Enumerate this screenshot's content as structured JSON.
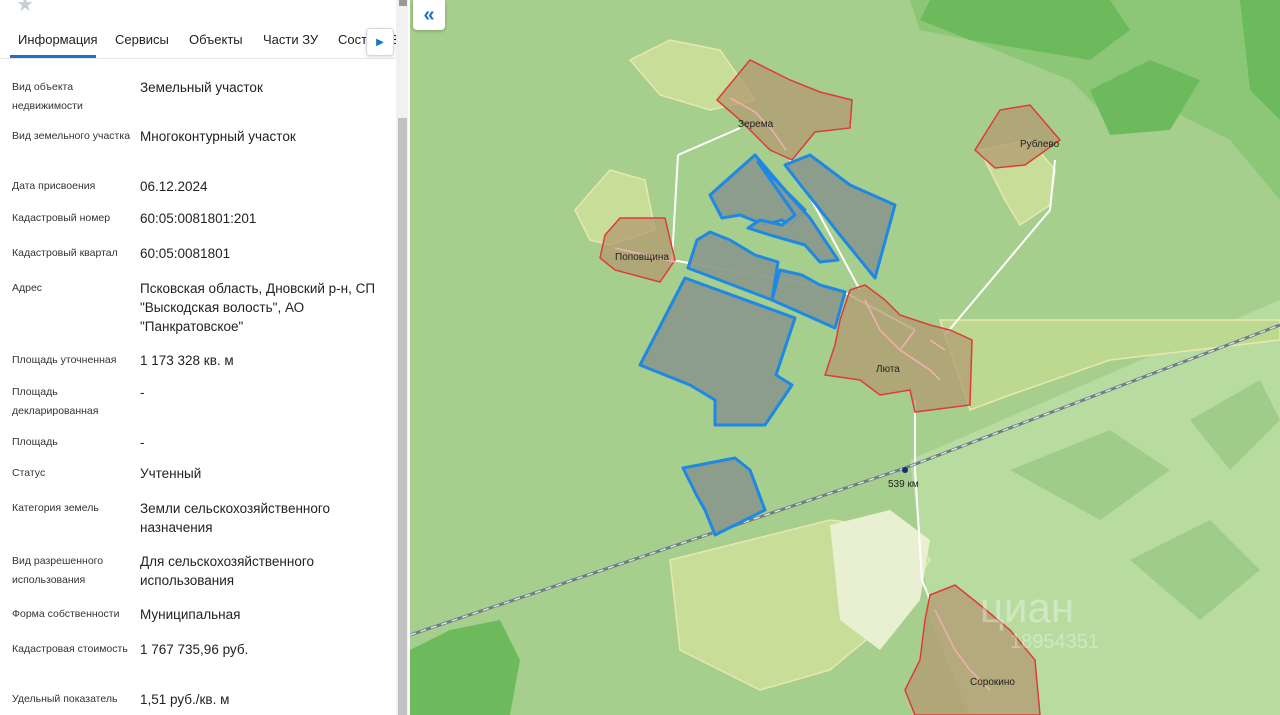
{
  "tabs": [
    "Информация",
    "Сервисы",
    "Объекты",
    "Части ЗУ",
    "Соста",
    "В"
  ],
  "properties": [
    {
      "label": "Вид объекта недвижимости",
      "value": "Земельный участок"
    },
    {
      "label": "Вид земельного участка",
      "value": "Многоконтурный участок"
    },
    {
      "label": "Дата присвоения",
      "value": "06.12.2024"
    },
    {
      "label": "Кадастровый номер",
      "value": "60:05:0081801:201"
    },
    {
      "label": "Кадастровый квартал",
      "value": "60:05:0081801"
    },
    {
      "label": "Адрес",
      "value": "Псковская область, Дновский р-н, СП \"Выскодская волость\", АО \"Панкратовское\""
    },
    {
      "label": "Площадь уточненная",
      "value": "1 173 328 кв. м"
    },
    {
      "label": "Площадь декларированная",
      "value": "-"
    },
    {
      "label": "Площадь",
      "value": "-"
    },
    {
      "label": "Статус",
      "value": "Учтенный"
    },
    {
      "label": "Категория земель",
      "value": "Земли сельскохозяйственного назначения"
    },
    {
      "label": "Вид разрешенного использования",
      "value": "Для сельскохозяйственного использования"
    },
    {
      "label": "Форма собственности",
      "value": "Муниципальная"
    },
    {
      "label": "Кадастровая стоимость",
      "value": "1 767 735,96 руб."
    },
    {
      "label": "Удельный показатель",
      "value": "1,51 руб./кв. м"
    }
  ],
  "map": {
    "collapse_icon": "«",
    "villages": [
      "Зерема",
      "Рублево",
      "Поповщина",
      "Люта",
      "Сорокино"
    ],
    "railway_km": "539 км",
    "watermark": "циан",
    "watermark_number": "18954351"
  },
  "colors": {
    "accent": "#1a73c9",
    "parcel_fill": "#8a9a8c",
    "parcel_stroke": "#1e88e5",
    "village_fill": "#b39a72",
    "village_stroke": "#e03a3a",
    "field": "#a6cf8d",
    "forest": "#6cba5c"
  }
}
